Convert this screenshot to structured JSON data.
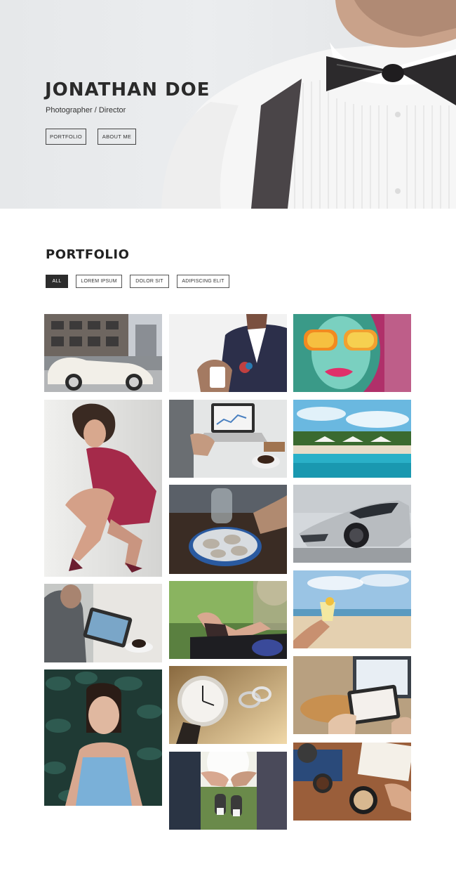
{
  "hero": {
    "name": "JONATHAN DOE",
    "subtitle": "Photographer / Director",
    "buttons": {
      "portfolio": "PORTFOLIO",
      "about": "ABOUT ME"
    }
  },
  "portfolio": {
    "title": "PORTFOLIO",
    "filters": [
      "ALL",
      "LOREM IPSUM",
      "DOLOR SIT",
      "ADIPISCING ELIT"
    ],
    "active_filter": "ALL"
  },
  "colors": {
    "accent_dark": "#2c2c2c",
    "hero_bg": "#e8eaec"
  }
}
